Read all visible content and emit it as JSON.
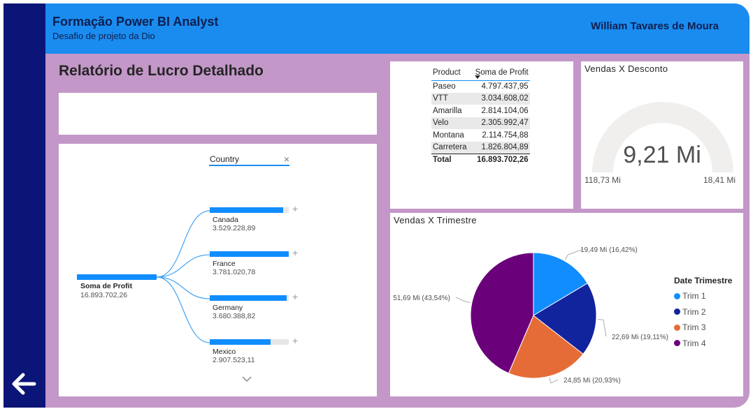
{
  "header": {
    "title": "Formação Power BI Analyst",
    "subtitle": "Desafio de projeto da Dio",
    "user": "William Tavares de Moura"
  },
  "page_title": "Relatório de Lucro Detalhado",
  "decomposition": {
    "root_label": "Soma de Profit",
    "root_value": "16.893.702,26",
    "level_field": "Country",
    "nodes": [
      {
        "name": "Canada",
        "value": "3.529.228,89",
        "fraction": 0.933
      },
      {
        "name": "France",
        "value": "3.781.020,78",
        "fraction": 1.0
      },
      {
        "name": "Germany",
        "value": "3.680.388,82",
        "fraction": 0.973
      },
      {
        "name": "Mexico",
        "value": "2.907.523,11",
        "fraction": 0.769
      }
    ],
    "icons": {
      "close": "close-icon",
      "expand": "plus-icon",
      "more": "chevron-down-icon"
    }
  },
  "product_table": {
    "col_product": "Product",
    "col_profit": "Soma de Profit",
    "rows": [
      {
        "product": "Paseo",
        "profit": "4.797.437,95"
      },
      {
        "product": "VTT",
        "profit": "3.034.608,02"
      },
      {
        "product": "Amarilla",
        "profit": "2.814.104,06"
      },
      {
        "product": "Velo",
        "profit": "2.305.992,47"
      },
      {
        "product": "Montana",
        "profit": "2.114.754,88"
      },
      {
        "product": "Carretera",
        "profit": "1.826.804,89"
      }
    ],
    "total_label": "Total",
    "total_value": "16.893.702,26"
  },
  "gauge": {
    "title": "Vendas X Desconto",
    "value_label": "9,21 Mi",
    "min_label": "118,73 Mi",
    "max_label": "18,41 Mi",
    "fill_fraction": 0
  },
  "pie": {
    "title": "Vendas X Trimestre",
    "legend_title": "Date Trimestre",
    "colors": {
      "Trim 1": "#118dff",
      "Trim 2": "#12239e",
      "Trim 3": "#e66c37",
      "Trim 4": "#6b007b"
    }
  },
  "chart_data": {
    "type": "pie",
    "title": "Vendas X Trimestre",
    "categories": [
      "Trim 1",
      "Trim 2",
      "Trim 3",
      "Trim 4"
    ],
    "values": [
      19.49,
      22.69,
      24.85,
      51.69
    ],
    "labels": [
      "19,49 Mi (16,42%)",
      "22,69 Mi (19,11%)",
      "24,85 Mi (20,93%)",
      "51,69 Mi (43,54%)"
    ],
    "legend": "right"
  }
}
